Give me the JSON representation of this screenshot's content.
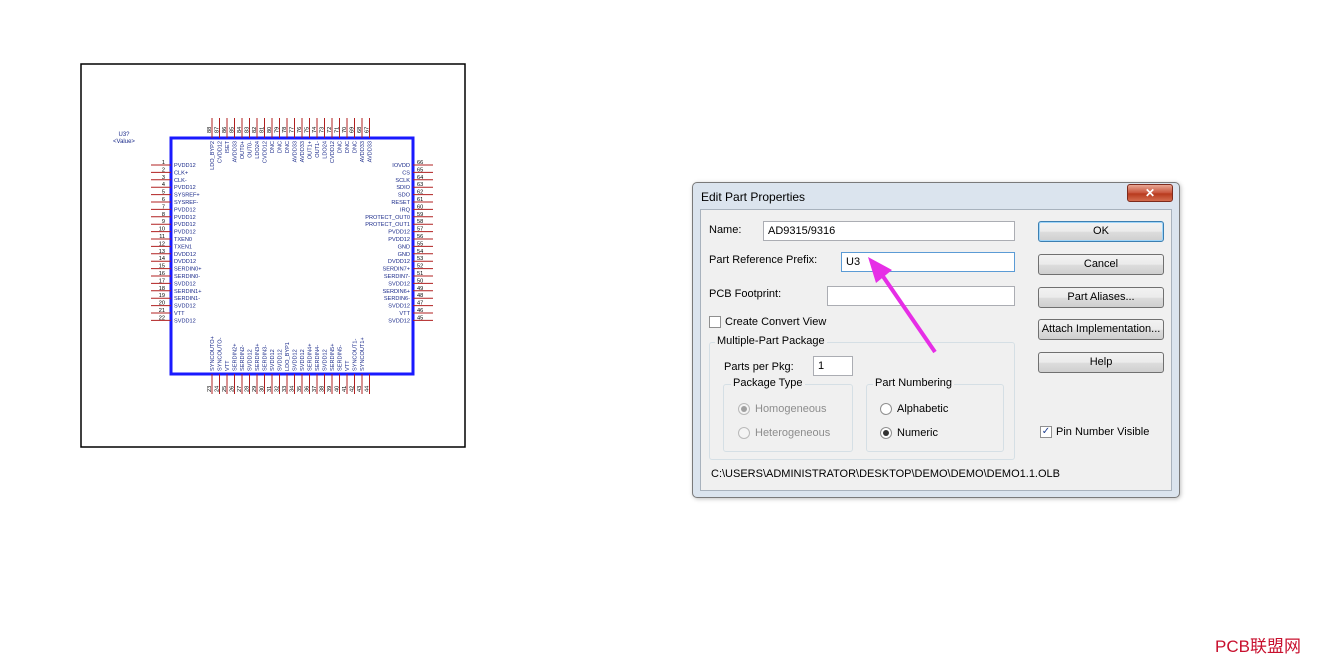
{
  "schematic": {
    "ref": "U3?",
    "value": "<Value>",
    "left_pins": [
      {
        "n": "1",
        "name": "PVDD12"
      },
      {
        "n": "2",
        "name": "CLK+"
      },
      {
        "n": "3",
        "name": "CLK-"
      },
      {
        "n": "4",
        "name": "PVDD12"
      },
      {
        "n": "5",
        "name": "SYSREF+"
      },
      {
        "n": "6",
        "name": "SYSREF-"
      },
      {
        "n": "7",
        "name": "PVDD12"
      },
      {
        "n": "8",
        "name": "PVDD12"
      },
      {
        "n": "9",
        "name": "PVDD12"
      },
      {
        "n": "10",
        "name": "PVDD12"
      },
      {
        "n": "11",
        "name": "TXEN0"
      },
      {
        "n": "12",
        "name": "TXEN1"
      },
      {
        "n": "13",
        "name": "DVDD12"
      },
      {
        "n": "14",
        "name": "DVDD12"
      },
      {
        "n": "15",
        "name": "SERDIN0+"
      },
      {
        "n": "16",
        "name": "SERDIN0-"
      },
      {
        "n": "17",
        "name": "SVDD12"
      },
      {
        "n": "18",
        "name": "SERDIN1+"
      },
      {
        "n": "19",
        "name": "SERDIN1-"
      },
      {
        "n": "20",
        "name": "SVDD12"
      },
      {
        "n": "21",
        "name": "VTT"
      },
      {
        "n": "22",
        "name": "SVDD12"
      }
    ],
    "right_pins": [
      {
        "n": "66",
        "name": "IOVDD"
      },
      {
        "n": "65",
        "name": "CS"
      },
      {
        "n": "64",
        "name": "SCLK"
      },
      {
        "n": "63",
        "name": "SDIO"
      },
      {
        "n": "62",
        "name": "SDO"
      },
      {
        "n": "61",
        "name": "RESET"
      },
      {
        "n": "60",
        "name": "IRQ"
      },
      {
        "n": "59",
        "name": "PROTECT_OUT0"
      },
      {
        "n": "58",
        "name": "PROTECT_OUT1"
      },
      {
        "n": "57",
        "name": "PVDD12"
      },
      {
        "n": "56",
        "name": "PVDD12"
      },
      {
        "n": "55",
        "name": "GND"
      },
      {
        "n": "54",
        "name": "GND"
      },
      {
        "n": "53",
        "name": "DVDD12"
      },
      {
        "n": "52",
        "name": "SERDIN7+"
      },
      {
        "n": "51",
        "name": "SERDIN7-"
      },
      {
        "n": "50",
        "name": "SVDD12"
      },
      {
        "n": "49",
        "name": "SERDIN6+"
      },
      {
        "n": "48",
        "name": "SERDIN6-"
      },
      {
        "n": "47",
        "name": "SVDD12"
      },
      {
        "n": "46",
        "name": "VTT"
      },
      {
        "n": "45",
        "name": "SVDD12"
      }
    ],
    "top_pins": [
      {
        "n": "88",
        "name": "LDO_BYP2"
      },
      {
        "n": "87",
        "name": "CVDD12"
      },
      {
        "n": "86",
        "name": "ISET"
      },
      {
        "n": "85",
        "name": "AVDD33"
      },
      {
        "n": "84",
        "name": "OUT0+"
      },
      {
        "n": "83",
        "name": "OUT0-"
      },
      {
        "n": "82",
        "name": "LDO24"
      },
      {
        "n": "81",
        "name": "CVDD12"
      },
      {
        "n": "80",
        "name": "DNC"
      },
      {
        "n": "79",
        "name": "DNC"
      },
      {
        "n": "78",
        "name": "DNC"
      },
      {
        "n": "77",
        "name": "AVDD33"
      },
      {
        "n": "76",
        "name": "AVDD33"
      },
      {
        "n": "75",
        "name": "OUT1+"
      },
      {
        "n": "74",
        "name": "OUT1-"
      },
      {
        "n": "73",
        "name": "LDO24"
      },
      {
        "n": "72",
        "name": "CVDD12"
      },
      {
        "n": "71",
        "name": "DNC"
      },
      {
        "n": "70",
        "name": "DNC"
      },
      {
        "n": "69",
        "name": "DNC"
      },
      {
        "n": "68",
        "name": "AVDD33"
      },
      {
        "n": "67",
        "name": "AVDD33"
      }
    ],
    "bottom_pins": [
      {
        "n": "23",
        "name": "SYNCOUTO+"
      },
      {
        "n": "24",
        "name": "SYNCOUTO-"
      },
      {
        "n": "25",
        "name": "VTT"
      },
      {
        "n": "26",
        "name": "SERDIN2+"
      },
      {
        "n": "27",
        "name": "SERDIN2-"
      },
      {
        "n": "28",
        "name": "SVDD12"
      },
      {
        "n": "29",
        "name": "SERDIN3+"
      },
      {
        "n": "30",
        "name": "SERDIN3-"
      },
      {
        "n": "31",
        "name": "SVDD12"
      },
      {
        "n": "32",
        "name": "SVDD12"
      },
      {
        "n": "33",
        "name": "LDO_BYP1"
      },
      {
        "n": "34",
        "name": "SVDD12"
      },
      {
        "n": "35",
        "name": "SVDD12"
      },
      {
        "n": "36",
        "name": "SERDIN4+"
      },
      {
        "n": "37",
        "name": "SERDIN4-"
      },
      {
        "n": "38",
        "name": "SVDD12"
      },
      {
        "n": "39",
        "name": "SERDIN5+"
      },
      {
        "n": "40",
        "name": "SERDIN5-"
      },
      {
        "n": "41",
        "name": "VTT"
      },
      {
        "n": "42",
        "name": "SYNCOUT1-"
      },
      {
        "n": "43",
        "name": "SYNCOUT1+"
      },
      {
        "n": "44",
        "name": ""
      }
    ],
    "colors": {
      "body": "#1a1aff",
      "pin": "#b02020",
      "text": "#1a2a8a",
      "frame": "#000000"
    }
  },
  "dialog": {
    "title": "Edit Part Properties",
    "close_glyph": "✕",
    "name_label": "Name:",
    "name_value": "AD9315/9316",
    "prefix_label": "Part Reference Prefix:",
    "prefix_value": "U3",
    "footprint_label": "PCB Footprint:",
    "footprint_value": "",
    "create_convert_label": "Create Convert View",
    "create_convert_checked": false,
    "multi_group_title": "Multiple-Part Package",
    "parts_label": "Parts per Pkg:",
    "parts_value": "1",
    "pkg_type_title": "Package Type",
    "homogeneous_label": "Homogeneous",
    "heterogeneous_label": "Heterogeneous",
    "part_numbering_title": "Part Numbering",
    "alphabetic_label": "Alphabetic",
    "numeric_label": "Numeric",
    "pin_number_visible_label": "Pin Number Visible",
    "pin_number_visible_checked": true,
    "ok_label": "OK",
    "cancel_label": "Cancel",
    "aliases_label": "Part Aliases...",
    "attach_label": "Attach Implementation...",
    "help_label": "Help",
    "path": "C:\\USERS\\ADMINISTRATOR\\DESKTOP\\DEMO\\DEMO\\DEMO1.1.OLB"
  },
  "watermark": "PCB联盟网",
  "arrow_color": "#e62ee6"
}
